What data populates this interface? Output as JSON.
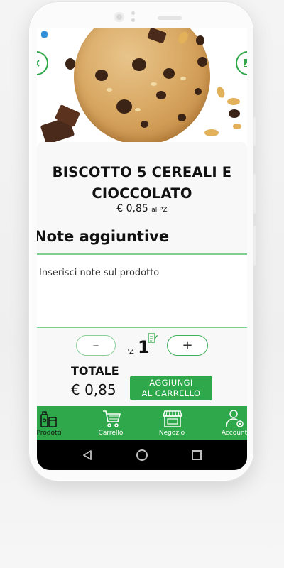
{
  "product": {
    "title": "BISCOTTO 5 CEREALI E CIOCCOLATO",
    "price": "€ 0,85",
    "unit": "al PZ"
  },
  "notes": {
    "title": "Note aggiuntive",
    "placeholder": "Inserisci note sul prodotto"
  },
  "quantity": {
    "minus_label": "–",
    "plus_label": "+",
    "unit": "PZ",
    "value": "1"
  },
  "total": {
    "label": "TOTALE",
    "value": "€ 0,85"
  },
  "cart_button": {
    "line1": "AGGIUNGI",
    "line2": "AL CARRELLO"
  },
  "tabs": [
    {
      "label": "Prodotti",
      "icon": "products-icon",
      "active": true
    },
    {
      "label": "Carrello",
      "icon": "cart-icon",
      "active": false
    },
    {
      "label": "Negozio",
      "icon": "store-icon",
      "active": false
    },
    {
      "label": "Account",
      "icon": "account-icon",
      "active": false
    }
  ],
  "colors": {
    "accent": "#2ea84a",
    "text": "#111111",
    "background": "#ffffff"
  }
}
